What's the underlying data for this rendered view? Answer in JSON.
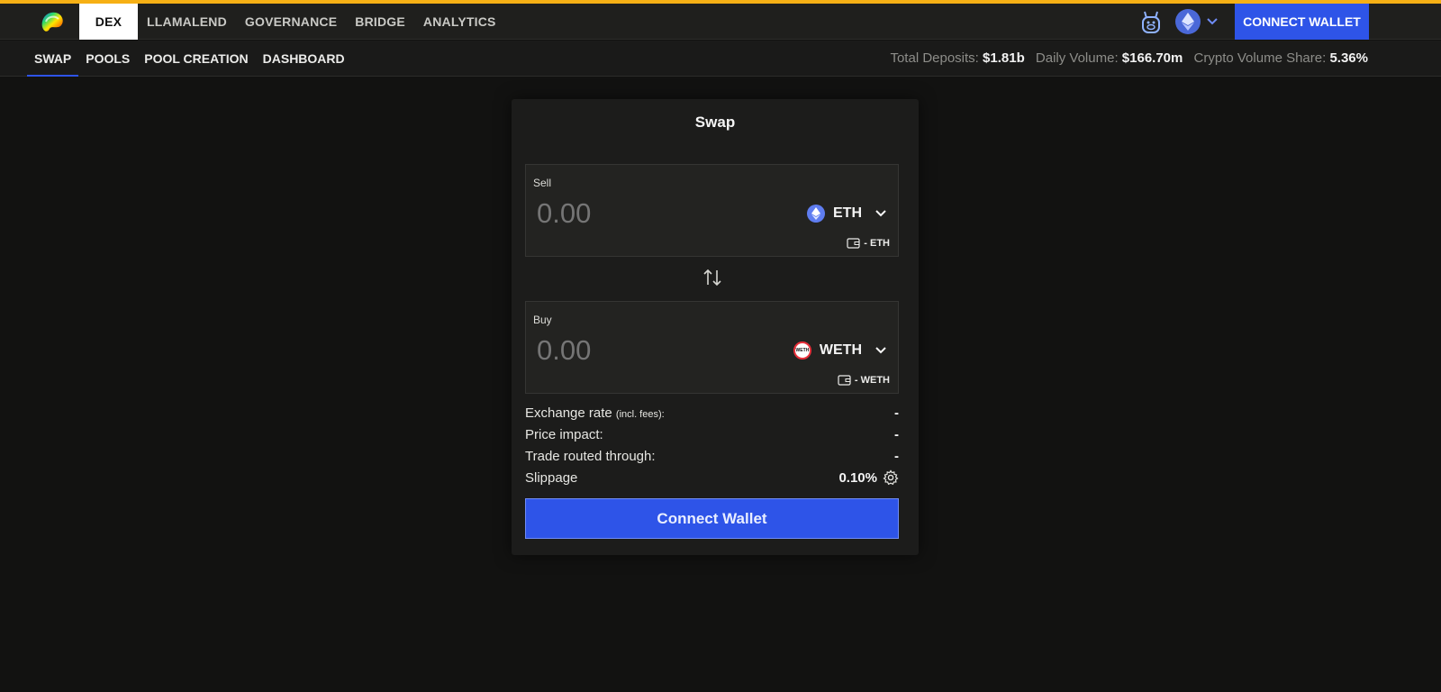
{
  "header": {
    "nav": [
      "DEX",
      "LLAMALEND",
      "GOVERNANCE",
      "BRIDGE",
      "ANALYTICS"
    ],
    "active_nav": "DEX",
    "connect_label": "CONNECT WALLET",
    "network_icon": "ethereum-icon",
    "accent_color": "#f6b015"
  },
  "subnav": {
    "items": [
      "SWAP",
      "POOLS",
      "POOL CREATION",
      "DASHBOARD"
    ],
    "active": "SWAP"
  },
  "stats": {
    "deposits_label": "Total Deposits:",
    "deposits_value": "$1.81b",
    "volume_label": "Daily Volume:",
    "volume_value": "$166.70m",
    "share_label": "Crypto Volume Share:",
    "share_value": "5.36%"
  },
  "swap": {
    "title": "Swap",
    "sell": {
      "label": "Sell",
      "amount": "0.00",
      "token": "ETH",
      "balance": "- ETH"
    },
    "buy": {
      "label": "Buy",
      "amount": "0.00",
      "token": "WETH",
      "token_badge": "WETH",
      "balance": "- WETH"
    },
    "exchange_rate_label": "Exchange rate",
    "exchange_rate_note": "(incl. fees):",
    "exchange_rate_value": "-",
    "price_impact_label": "Price impact:",
    "price_impact_value": "-",
    "routed_label": "Trade routed through:",
    "routed_value": "-",
    "slippage_label": "Slippage",
    "slippage_value": "0.10%",
    "connect_label": "Connect Wallet",
    "button_color": "#2e54e8"
  }
}
